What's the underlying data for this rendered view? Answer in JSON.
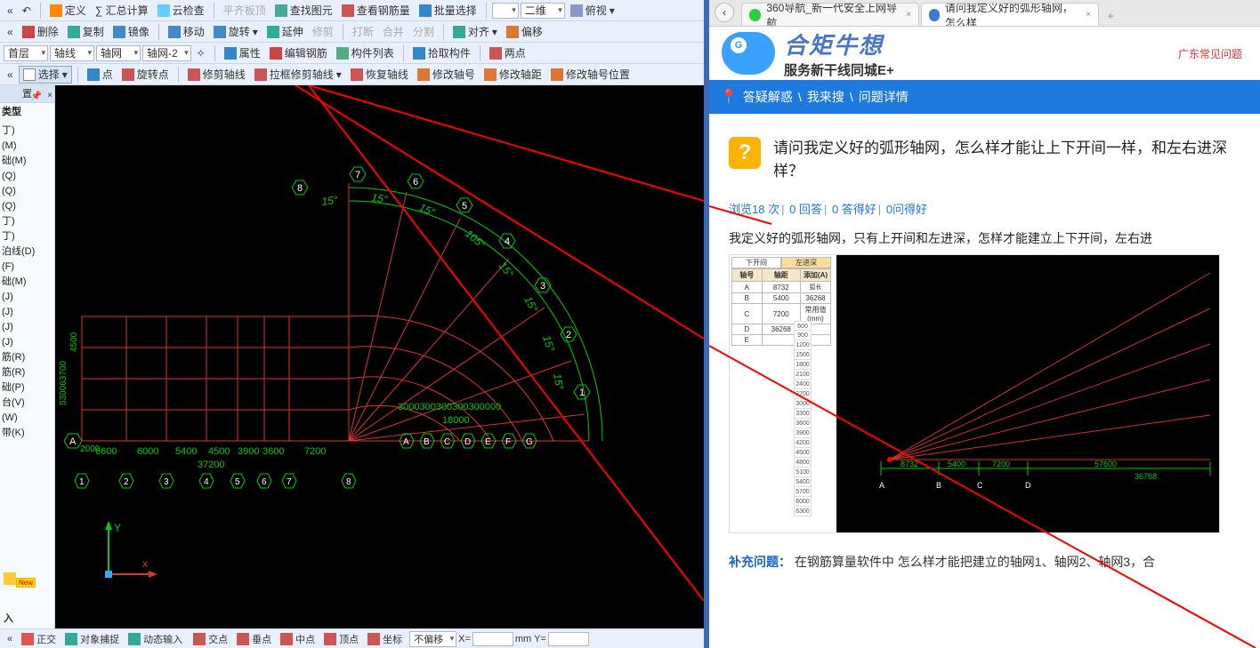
{
  "toolbar": {
    "row1": {
      "define": "定义",
      "sumcalc": "∑ 汇总计算",
      "cloudchk": "云检查",
      "flat": "平齐板顶",
      "findel": "查找图元",
      "viewbar": "查看钢筋量",
      "batch": "批量选择",
      "dim2": "二维",
      "persp": "俯视"
    },
    "row2": {
      "del": "删除",
      "copy": "复制",
      "mirror": "镜像",
      "move": "移动",
      "rotate": "旋转",
      "extend": "延伸",
      "trim": "修剪",
      "break": "打断",
      "merge": "合并",
      "split": "分割",
      "align": "对齐",
      "offset": "偏移"
    },
    "row3": {
      "floor": "首层",
      "axisline": "轴线",
      "grid": "轴网",
      "gridnum": "轴网-2",
      "prop": "属性",
      "editbar": "编辑钢筋",
      "complist": "构件列表",
      "extract": "拾取构件",
      "twopt": "两点"
    },
    "row4": {
      "select": "选择",
      "point": "点",
      "rotpt": "旋转点",
      "trimaxis": "修剪轴线",
      "boxtrim": "拉框修剪轴线",
      "restore": "恢复轴线",
      "modname": "修改轴号",
      "moddist": "修改轴距",
      "modpos": "修改轴号位置"
    }
  },
  "side": {
    "header": "置",
    "groups": {
      "type": "类型"
    },
    "items": [
      "丁)",
      "(M)",
      "础(M)",
      "(Q)",
      "(Q)",
      "(Q)",
      "丁)",
      "丁)",
      "泊线(D)",
      "(F)",
      "础(M)",
      "(J)",
      "(J)",
      "(J)",
      "(J)",
      "筋(R)",
      "筋(R)",
      "础(P)",
      "台(V)",
      "(W)",
      "带(K)"
    ],
    "newlbl": "New",
    "footer": "入"
  },
  "status": {
    "orth": "正交",
    "snap": "对象捕捉",
    "dyn": "动态输入",
    "xpt": "交点",
    "perp": "垂点",
    "mid": "中点",
    "apex": "顶点",
    "coord": "坐标",
    "nooffset": "不偏移",
    "xlbl": "X=",
    "ylbl": "mm Y="
  },
  "canvas": {
    "angles": [
      "15°",
      "15°",
      "15°",
      "105°",
      "15°",
      "15°",
      "15°",
      "15°",
      "15°"
    ],
    "top_bubbles": [
      "8",
      "7",
      "6",
      "5",
      "4",
      "3",
      "2",
      "1"
    ],
    "bot_letters": [
      "A",
      "B",
      "C",
      "D",
      "E",
      "F",
      "G"
    ],
    "bot_nums_row": [
      "1",
      "2",
      "3",
      "4",
      "5",
      "6",
      "7",
      "8"
    ],
    "dims_h": [
      "6600",
      "6000",
      "5400",
      "4500",
      "3900",
      "3600",
      "7200"
    ],
    "dim_total_h": "37200",
    "dim_radial": "3000300300300300300000",
    "dim_radial2": "18000",
    "left_v": [
      "530063700",
      "4500"
    ],
    "axisA": "A",
    "a_off": "2000",
    "axes": {
      "x": "x",
      "y": "Y"
    }
  },
  "browser": {
    "tabs": [
      {
        "title": "360导航_新一代安全上网导航",
        "fav": "#2ecc40"
      },
      {
        "title": "请问我定义好的弧形轴网，怎么样",
        "fav": "#3a7bd5"
      }
    ]
  },
  "brand": {
    "zh": "合矩牛想",
    "sub": "服务新干线同城E+",
    "region": "广东常见问题"
  },
  "nav": {
    "crumb1": "答疑解惑",
    "crumb2": "我来搜",
    "crumb3": "问题详情"
  },
  "question": {
    "title": "请问我定义好的弧形轴网，怎么样才能让上下开间一样，和左右进深样？",
    "stats": {
      "view": "浏览18 次",
      "ans": "0 回答",
      "good": "0 答得好",
      "ask": "0问得好"
    },
    "desc": "我定义好的弧形轴网，只有上开间和左进深，怎样才能建立上下开间，左右进",
    "mini": {
      "tab_a": "下开间",
      "tab_b": "左进深",
      "addcol": "添加(A)",
      "col1": "轴号",
      "col2": "轴距",
      "col3": "弧长",
      "rows": [
        {
          "a": "A",
          "b": "8732",
          "c": ""
        },
        {
          "a": "B",
          "b": "5400",
          "c": "36268"
        },
        {
          "a": "C",
          "b": "7200",
          "c": "常用值(mm)"
        },
        {
          "a": "D",
          "b": "36268",
          "c": ""
        },
        {
          "a": "E",
          "b": "",
          "c": ""
        }
      ],
      "strip": [
        "600",
        "900",
        "1200",
        "1500",
        "1800",
        "2100",
        "2400",
        "2700",
        "3000",
        "3300",
        "3600",
        "3900",
        "4200",
        "4500",
        "4800",
        "5100",
        "5400",
        "5700",
        "6000",
        "6300"
      ],
      "cad": {
        "labels": [
          "A",
          "B",
          "C",
          "D"
        ],
        "dims": [
          "8732",
          "5400",
          "7200",
          "57600",
          "36268"
        ]
      }
    },
    "supp_label": "补充问题：",
    "supp_text": "在钢筋算量软件中 怎么样才能把建立的轴网1、轴网2、轴网3，合"
  }
}
